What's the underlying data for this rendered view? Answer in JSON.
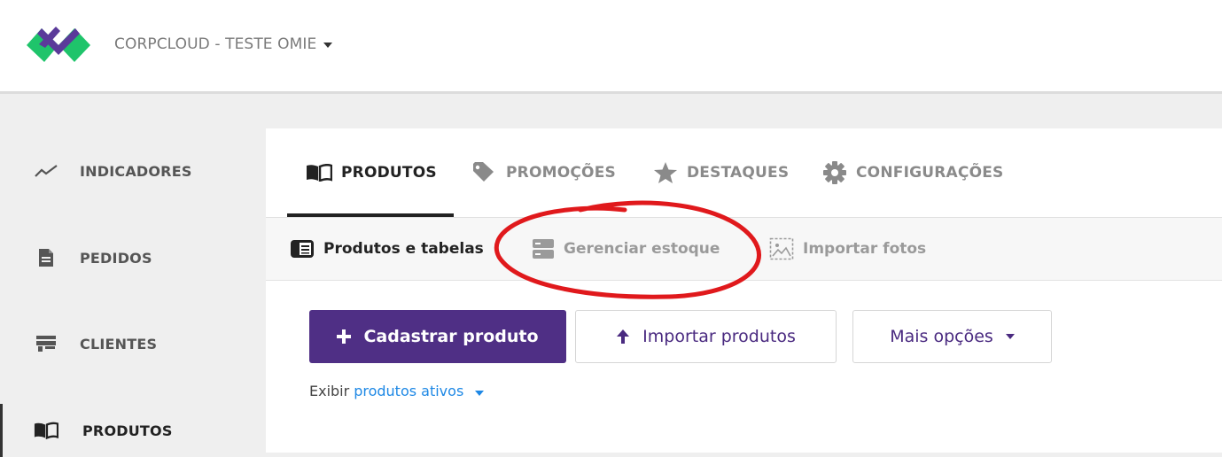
{
  "header": {
    "company": "CORPCLOUD - TESTE OMIE",
    "logo_icon": "omie-logo-icon"
  },
  "sidebar": {
    "items": [
      {
        "label": "INDICADORES",
        "icon": "trend-line-icon"
      },
      {
        "label": "PEDIDOS",
        "icon": "document-icon"
      },
      {
        "label": "CLIENTES",
        "icon": "store-icon"
      },
      {
        "label": "PRODUTOS",
        "icon": "open-book-icon",
        "active": true
      }
    ]
  },
  "tabs": [
    {
      "label": "PRODUTOS",
      "icon": "open-book-icon",
      "active": true
    },
    {
      "label": "PROMOÇÕES",
      "icon": "tag-icon"
    },
    {
      "label": "DESTAQUES",
      "icon": "star-icon"
    },
    {
      "label": "CONFIGURAÇÕES",
      "icon": "gear-icon"
    }
  ],
  "subtabs": [
    {
      "label": "Produtos e tabelas",
      "icon": "catalog-icon",
      "active": true
    },
    {
      "label": "Gerenciar estoque",
      "icon": "server-icon"
    },
    {
      "label": "Importar fotos",
      "icon": "image-icon"
    }
  ],
  "actions": {
    "add_product": "Cadastrar produto",
    "import_products": "Importar produtos",
    "more_options": "Mais opções"
  },
  "filter": {
    "prefix": "Exibir",
    "value": "produtos ativos"
  },
  "colors": {
    "primary": "#4f2f85",
    "link": "#1e88e5",
    "annotation": "#e0191c",
    "logo_green": "#1fc46b",
    "logo_purple": "#5b3a9a"
  }
}
